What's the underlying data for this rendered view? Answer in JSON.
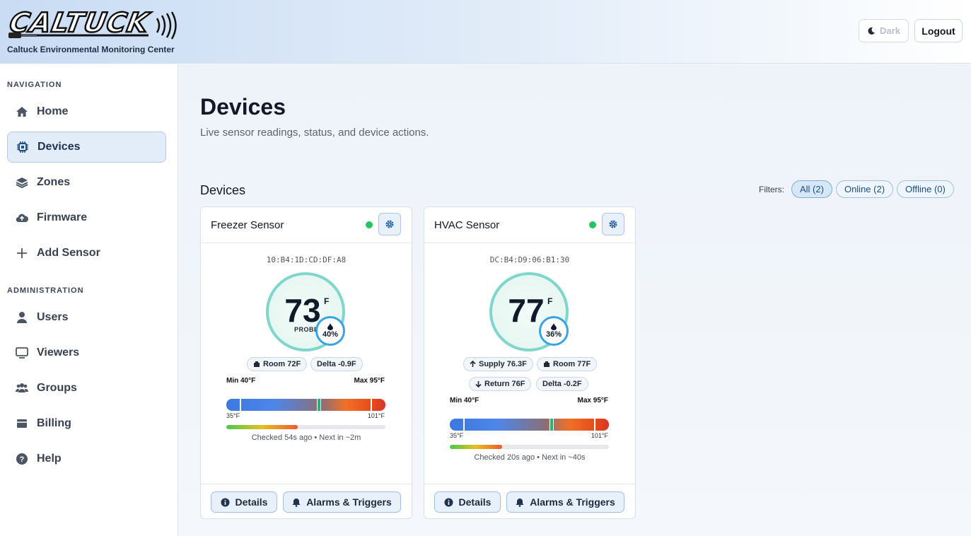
{
  "header": {
    "logo_text": "CALTUCK",
    "subtitle": "Caltuck Environmental Monitoring Center",
    "dark_label": "Dark",
    "logout_label": "Logout"
  },
  "sidebar": {
    "nav_heading": "NAVIGATION",
    "admin_heading": "ADMINISTRATION",
    "nav_items": [
      {
        "label": "Home",
        "icon": "home-icon"
      },
      {
        "label": "Devices",
        "icon": "chip-icon",
        "active": true
      },
      {
        "label": "Zones",
        "icon": "layers-icon"
      },
      {
        "label": "Firmware",
        "icon": "cloud-upload-icon"
      },
      {
        "label": "Add Sensor",
        "icon": "plus-icon"
      }
    ],
    "admin_items": [
      {
        "label": "Users",
        "icon": "user-icon"
      },
      {
        "label": "Viewers",
        "icon": "monitor-icon"
      },
      {
        "label": "Groups",
        "icon": "users-icon"
      },
      {
        "label": "Billing",
        "icon": "billing-icon"
      },
      {
        "label": "Help",
        "icon": "help-icon"
      }
    ]
  },
  "main": {
    "title": "Devices",
    "subtitle": "Live sensor readings, status, and device actions.",
    "section_title": "Devices",
    "filters_label": "Filters:",
    "filters": [
      "All (2)",
      "Online (2)",
      "Offline (0)"
    ]
  },
  "devices": [
    {
      "name": "Freezer Sensor",
      "mac": "10:B4:1D:CD:DF:A8",
      "temp": "73",
      "unit": "F",
      "probe_label": "PROBE",
      "humidity": "40%",
      "pills": [
        "Room 72F",
        "Delta -0.9F"
      ],
      "min_label": "Min 40°F",
      "max_label": "Max 95°F",
      "scale_min": "35°F",
      "scale_max": "101°F",
      "current_fraction": 0.58,
      "poll_progress": 0.45,
      "checked": "Checked 54s ago • Next in ~2m",
      "details_label": "Details",
      "alarms_label": "Alarms & Triggers",
      "status_color": "#22c55e"
    },
    {
      "name": "HVAC Sensor",
      "mac": "DC:B4:D9:06:B1:30",
      "temp": "77",
      "unit": "F",
      "humidity": "36%",
      "pills": [
        "Supply 76.3F",
        "Room 77F",
        "Return 76F",
        "Delta -0.2F"
      ],
      "min_label": "Min 40°F",
      "max_label": "Max 95°F",
      "scale_min": "35°F",
      "scale_max": "101°F",
      "current_fraction": 0.64,
      "poll_progress": 0.33,
      "checked": "Checked 20s ago • Next in ~40s",
      "details_label": "Details",
      "alarms_label": "Alarms & Triggers",
      "status_color": "#22c55e"
    }
  ]
}
